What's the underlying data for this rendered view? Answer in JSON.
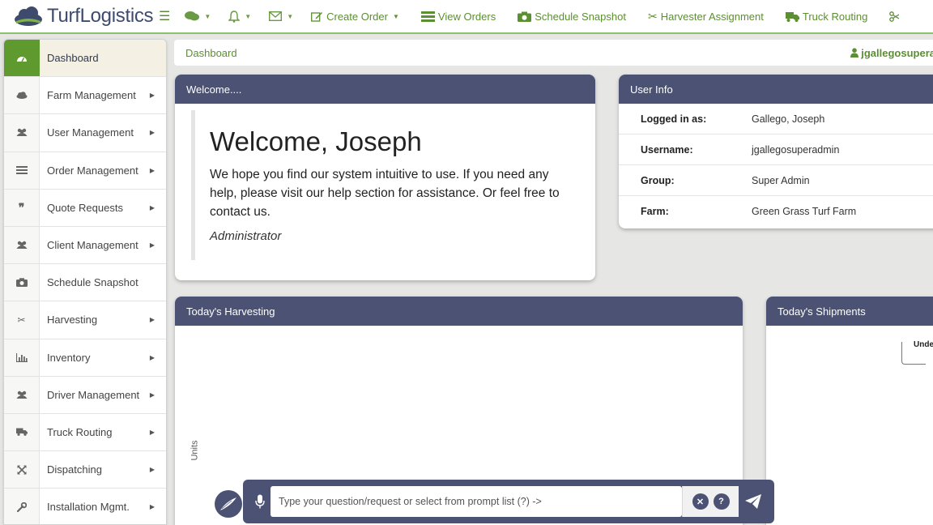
{
  "app": {
    "logo_text": "TurfLogistics"
  },
  "topnav": {
    "links": [
      {
        "label": "Create Order",
        "icon": "edit-icon",
        "dropdown": true
      },
      {
        "label": "View Orders",
        "icon": "list-icon"
      },
      {
        "label": "Schedule Snapshot",
        "icon": "camera-icon"
      },
      {
        "label": "Harvester Assignment",
        "icon": "scissors-icon"
      },
      {
        "label": "Truck Routing",
        "icon": "truck-icon"
      }
    ]
  },
  "sidebar": {
    "items": [
      {
        "label": "Dashboard",
        "icon": "dashboard-icon",
        "active": true
      },
      {
        "label": "Farm Management",
        "icon": "cloud-icon"
      },
      {
        "label": "User Management",
        "icon": "users-icon"
      },
      {
        "label": "Order Management",
        "icon": "list-icon"
      },
      {
        "label": "Quote Requests",
        "icon": "quote-icon"
      },
      {
        "label": "Client Management",
        "icon": "users-icon"
      },
      {
        "label": "Schedule Snapshot",
        "icon": "camera-icon"
      },
      {
        "label": "Harvesting",
        "icon": "scissors-icon"
      },
      {
        "label": "Inventory",
        "icon": "bar-chart-icon"
      },
      {
        "label": "Driver Management",
        "icon": "users-icon"
      },
      {
        "label": "Truck Routing",
        "icon": "truck-icon"
      },
      {
        "label": "Dispatching",
        "icon": "expand-icon"
      },
      {
        "label": "Installation Mgmt.",
        "icon": "wrench-icon"
      }
    ]
  },
  "breadcrumb": {
    "current": "Dashboard",
    "user": "jgallegosupera"
  },
  "welcome_panel": {
    "title": "Welcome....",
    "heading": "Welcome, Joseph",
    "message": "We hope you find our system intuitive to use. If you need any help, please visit our help section for assistance. Or feel free to contact us.",
    "signature": "Administrator"
  },
  "user_info": {
    "title": "User Info",
    "rows": [
      {
        "key": "Logged in as:",
        "value": "Gallego, Joseph"
      },
      {
        "key": "Username:",
        "value": "jgallegosuperadmin"
      },
      {
        "key": "Group:",
        "value": "Super Admin"
      },
      {
        "key": "Farm:",
        "value": "Green Grass Turf Farm"
      }
    ]
  },
  "harvesting_panel": {
    "title": "Today's Harvesting",
    "y_label": "Units"
  },
  "shipments_panel": {
    "title": "Today's Shipments",
    "legend_fragment": "Unde"
  },
  "chat": {
    "placeholder": "Type your question/request or select from prompt list (?) ->",
    "clear_label": "✕",
    "help_label": "?"
  },
  "colors": {
    "accent_green": "#5f9a2e",
    "panel_header": "#4b5274"
  }
}
